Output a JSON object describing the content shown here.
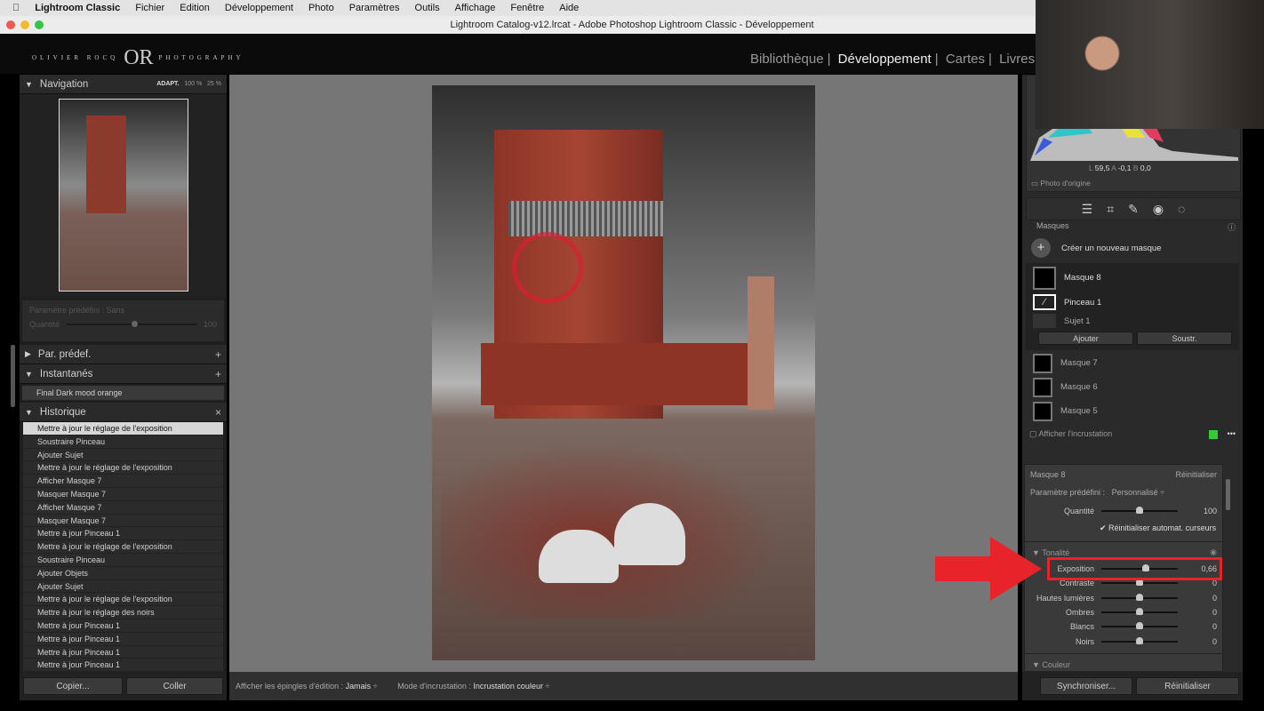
{
  "menubar": {
    "apple": "",
    "app": "Lightroom Classic",
    "items": [
      "Fichier",
      "Edition",
      "Développement",
      "Photo",
      "Paramètres",
      "Outils",
      "Affichage",
      "Fenêtre",
      "Aide"
    ]
  },
  "window": {
    "title": "Lightroom Catalog-v12.lrcat - Adobe Photoshop Lightroom Classic - Développement"
  },
  "identity_plate": {
    "left": "OLIVIER ROCQ",
    "mark": "OR",
    "right": "PHOTOGRAPHY"
  },
  "modules": [
    "Bibliothèque",
    "Développement",
    "Cartes",
    "Livres"
  ],
  "active_module": "Développement",
  "left_panel": {
    "navigation": {
      "title": "Navigation",
      "zoom_options": [
        "ADAPT.",
        "100 %",
        "25 %"
      ]
    },
    "preset_box": {
      "label": "Paramètre prédéfini : Sans",
      "amount_label": "Quantité",
      "amount_value": "100"
    },
    "presets": {
      "title": "Par. prédef."
    },
    "snapshots": {
      "title": "Instantanés",
      "items": [
        "Final Dark mood orange"
      ]
    },
    "history": {
      "title": "Historique",
      "items": [
        "Mettre à jour le réglage de l'exposition",
        "Soustraire Pinceau",
        "Ajouter Sujet",
        "Mettre à jour le réglage de l'exposition",
        "Afficher Masque 7",
        "Masquer Masque 7",
        "Afficher Masque 7",
        "Masquer Masque 7",
        "Mettre à jour Pinceau 1",
        "Mettre à jour le réglage de l'exposition",
        "Soustraire Pinceau",
        "Ajouter Objets",
        "Ajouter Sujet",
        "Mettre à jour le réglage de l'exposition",
        "Mettre à jour le réglage des noirs",
        "Mettre à jour Pinceau 1",
        "Mettre à jour Pinceau 1",
        "Mettre à jour Pinceau 1",
        "Mettre à jour Pinceau 1"
      ]
    },
    "copy_label": "Copier...",
    "paste_label": "Coller"
  },
  "toolbar": {
    "pins_label": "Afficher les épingles d'édition :",
    "pins_value": "Jamais",
    "overlay_label": "Mode d'incrustation :",
    "overlay_value": "Incrustation couleur"
  },
  "right_panel": {
    "histogram": {
      "L_label": "L",
      "L": "59,5",
      "A_label": "A",
      "A": "-0,1",
      "B_label": "B",
      "B": "0,0",
      "original_label": "Photo d'origine"
    },
    "tools": [
      "edit-sliders-icon",
      "crop-icon",
      "healing-icon",
      "red-eye-icon",
      "masking-icon"
    ],
    "masks": {
      "title": "Masques",
      "create_label": "Créer un nouveau masque",
      "items": [
        {
          "name": "Masque 8",
          "children": [
            "Pinceau 1",
            "Sujet 1"
          ]
        },
        {
          "name": "Masque 7"
        },
        {
          "name": "Masque 6"
        },
        {
          "name": "Masque 5"
        }
      ],
      "add_label": "Ajouter",
      "subtract_label": "Soustr.",
      "overlay_label": "Afficher l'incrustation",
      "overlay_color": "#33cc33"
    },
    "mask_settings": {
      "title": "Masque 8",
      "reset_label": "Réinitialiser",
      "preset_label": "Paramètre prédéfini :",
      "preset_value": "Personnalisé",
      "amount_label": "Quantité",
      "amount_value": "100",
      "amount_fraction": 0.5,
      "auto_reset_label": "Réinitialiser automat. curseurs",
      "auto_reset_checked": true
    },
    "tone": {
      "title": "Tonalité",
      "sliders": [
        {
          "label": "Exposition",
          "value": "0,66",
          "fraction": 0.58
        },
        {
          "label": "Contraste",
          "value": "0",
          "fraction": 0.5
        },
        {
          "label": "Hautes lumières",
          "value": "0",
          "fraction": 0.5
        },
        {
          "label": "Ombres",
          "value": "0",
          "fraction": 0.5
        },
        {
          "label": "Blancs",
          "value": "0",
          "fraction": 0.5
        },
        {
          "label": "Noirs",
          "value": "0",
          "fraction": 0.5
        }
      ]
    },
    "color": {
      "title": "Couleur"
    },
    "sync_label": "Synchroniser...",
    "reset_label": "Réinitialiser"
  },
  "annotation": {
    "highlight_color": "#e8232a"
  }
}
